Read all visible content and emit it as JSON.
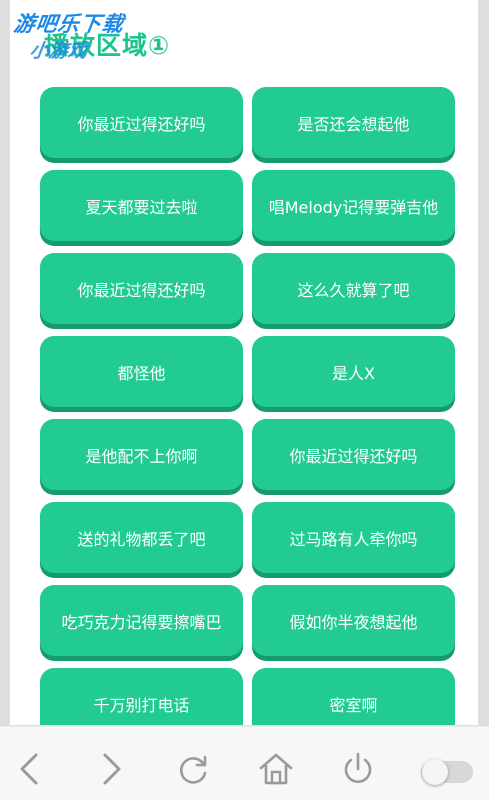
{
  "header": {
    "watermark_line1": "游吧乐下载",
    "watermark_line2": "小游戏",
    "section_title": "播放区域①"
  },
  "buttons": [
    {
      "label": "你最近过得还好吗"
    },
    {
      "label": "是否还会想起他"
    },
    {
      "label": "夏天都要过去啦"
    },
    {
      "label": "唱Melody记得要弹吉他"
    },
    {
      "label": "你最近过得还好吗"
    },
    {
      "label": "这么久就算了吧"
    },
    {
      "label": "都怪他"
    },
    {
      "label": "是人X"
    },
    {
      "label": "是他配不上你啊"
    },
    {
      "label": "你最近过得还好吗"
    },
    {
      "label": "送的礼物都丢了吧"
    },
    {
      "label": "过马路有人牵你吗"
    },
    {
      "label": "吃巧克力记得要擦嘴巴"
    },
    {
      "label": "假如你半夜想起他"
    },
    {
      "label": "千万别打电话"
    },
    {
      "label": "密室啊"
    }
  ],
  "bottom_bar": {
    "icons": [
      "back-arrow-icon",
      "forward-arrow-icon",
      "refresh-icon",
      "home-icon",
      "power-icon"
    ],
    "toggle_state": "off"
  },
  "colors": {
    "accent": "#22cc91",
    "accent_shadow": "#179a6c",
    "icon_gray": "#9a9a9a"
  }
}
